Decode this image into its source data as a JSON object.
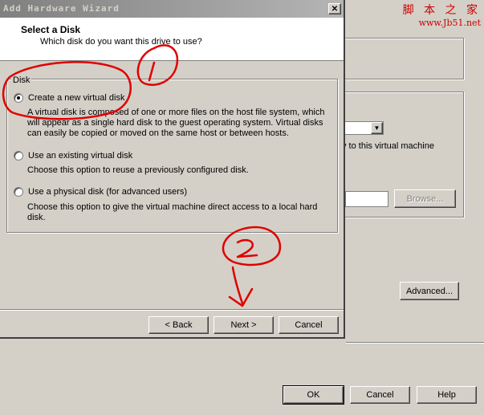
{
  "watermark": {
    "line1": "脚 本 之 家",
    "line2": "www.Jb51.net"
  },
  "background_window": {
    "partial_text": "y to this virtual machine",
    "browse_label": "Browse...",
    "advanced_label": "Advanced...",
    "ok_label": "OK",
    "cancel_label": "Cancel",
    "help_label": "Help"
  },
  "wizard": {
    "title": "Add Hardware Wizard",
    "close_glyph": "✕",
    "header_title": "Select a Disk",
    "header_subtitle": "Which disk do you want this drive to use?",
    "group_label": "Disk",
    "options": [
      {
        "label": "Create a new virtual disk",
        "selected": true,
        "description": "A virtual disk is composed of one or more files on the host file system, which will appear as a single hard disk to the guest operating system. Virtual disks can easily be copied or moved on the same host or between hosts."
      },
      {
        "label": "Use an existing virtual disk",
        "selected": false,
        "description": "Choose this option to reuse a previously configured disk."
      },
      {
        "label": "Use a physical disk (for advanced users)",
        "selected": false,
        "description": "Choose this option to give the virtual machine direct access to a local hard disk."
      }
    ],
    "back_label": "< Back",
    "next_label": "Next >",
    "cancel_label": "Cancel"
  },
  "annotation_color": "#e00000"
}
